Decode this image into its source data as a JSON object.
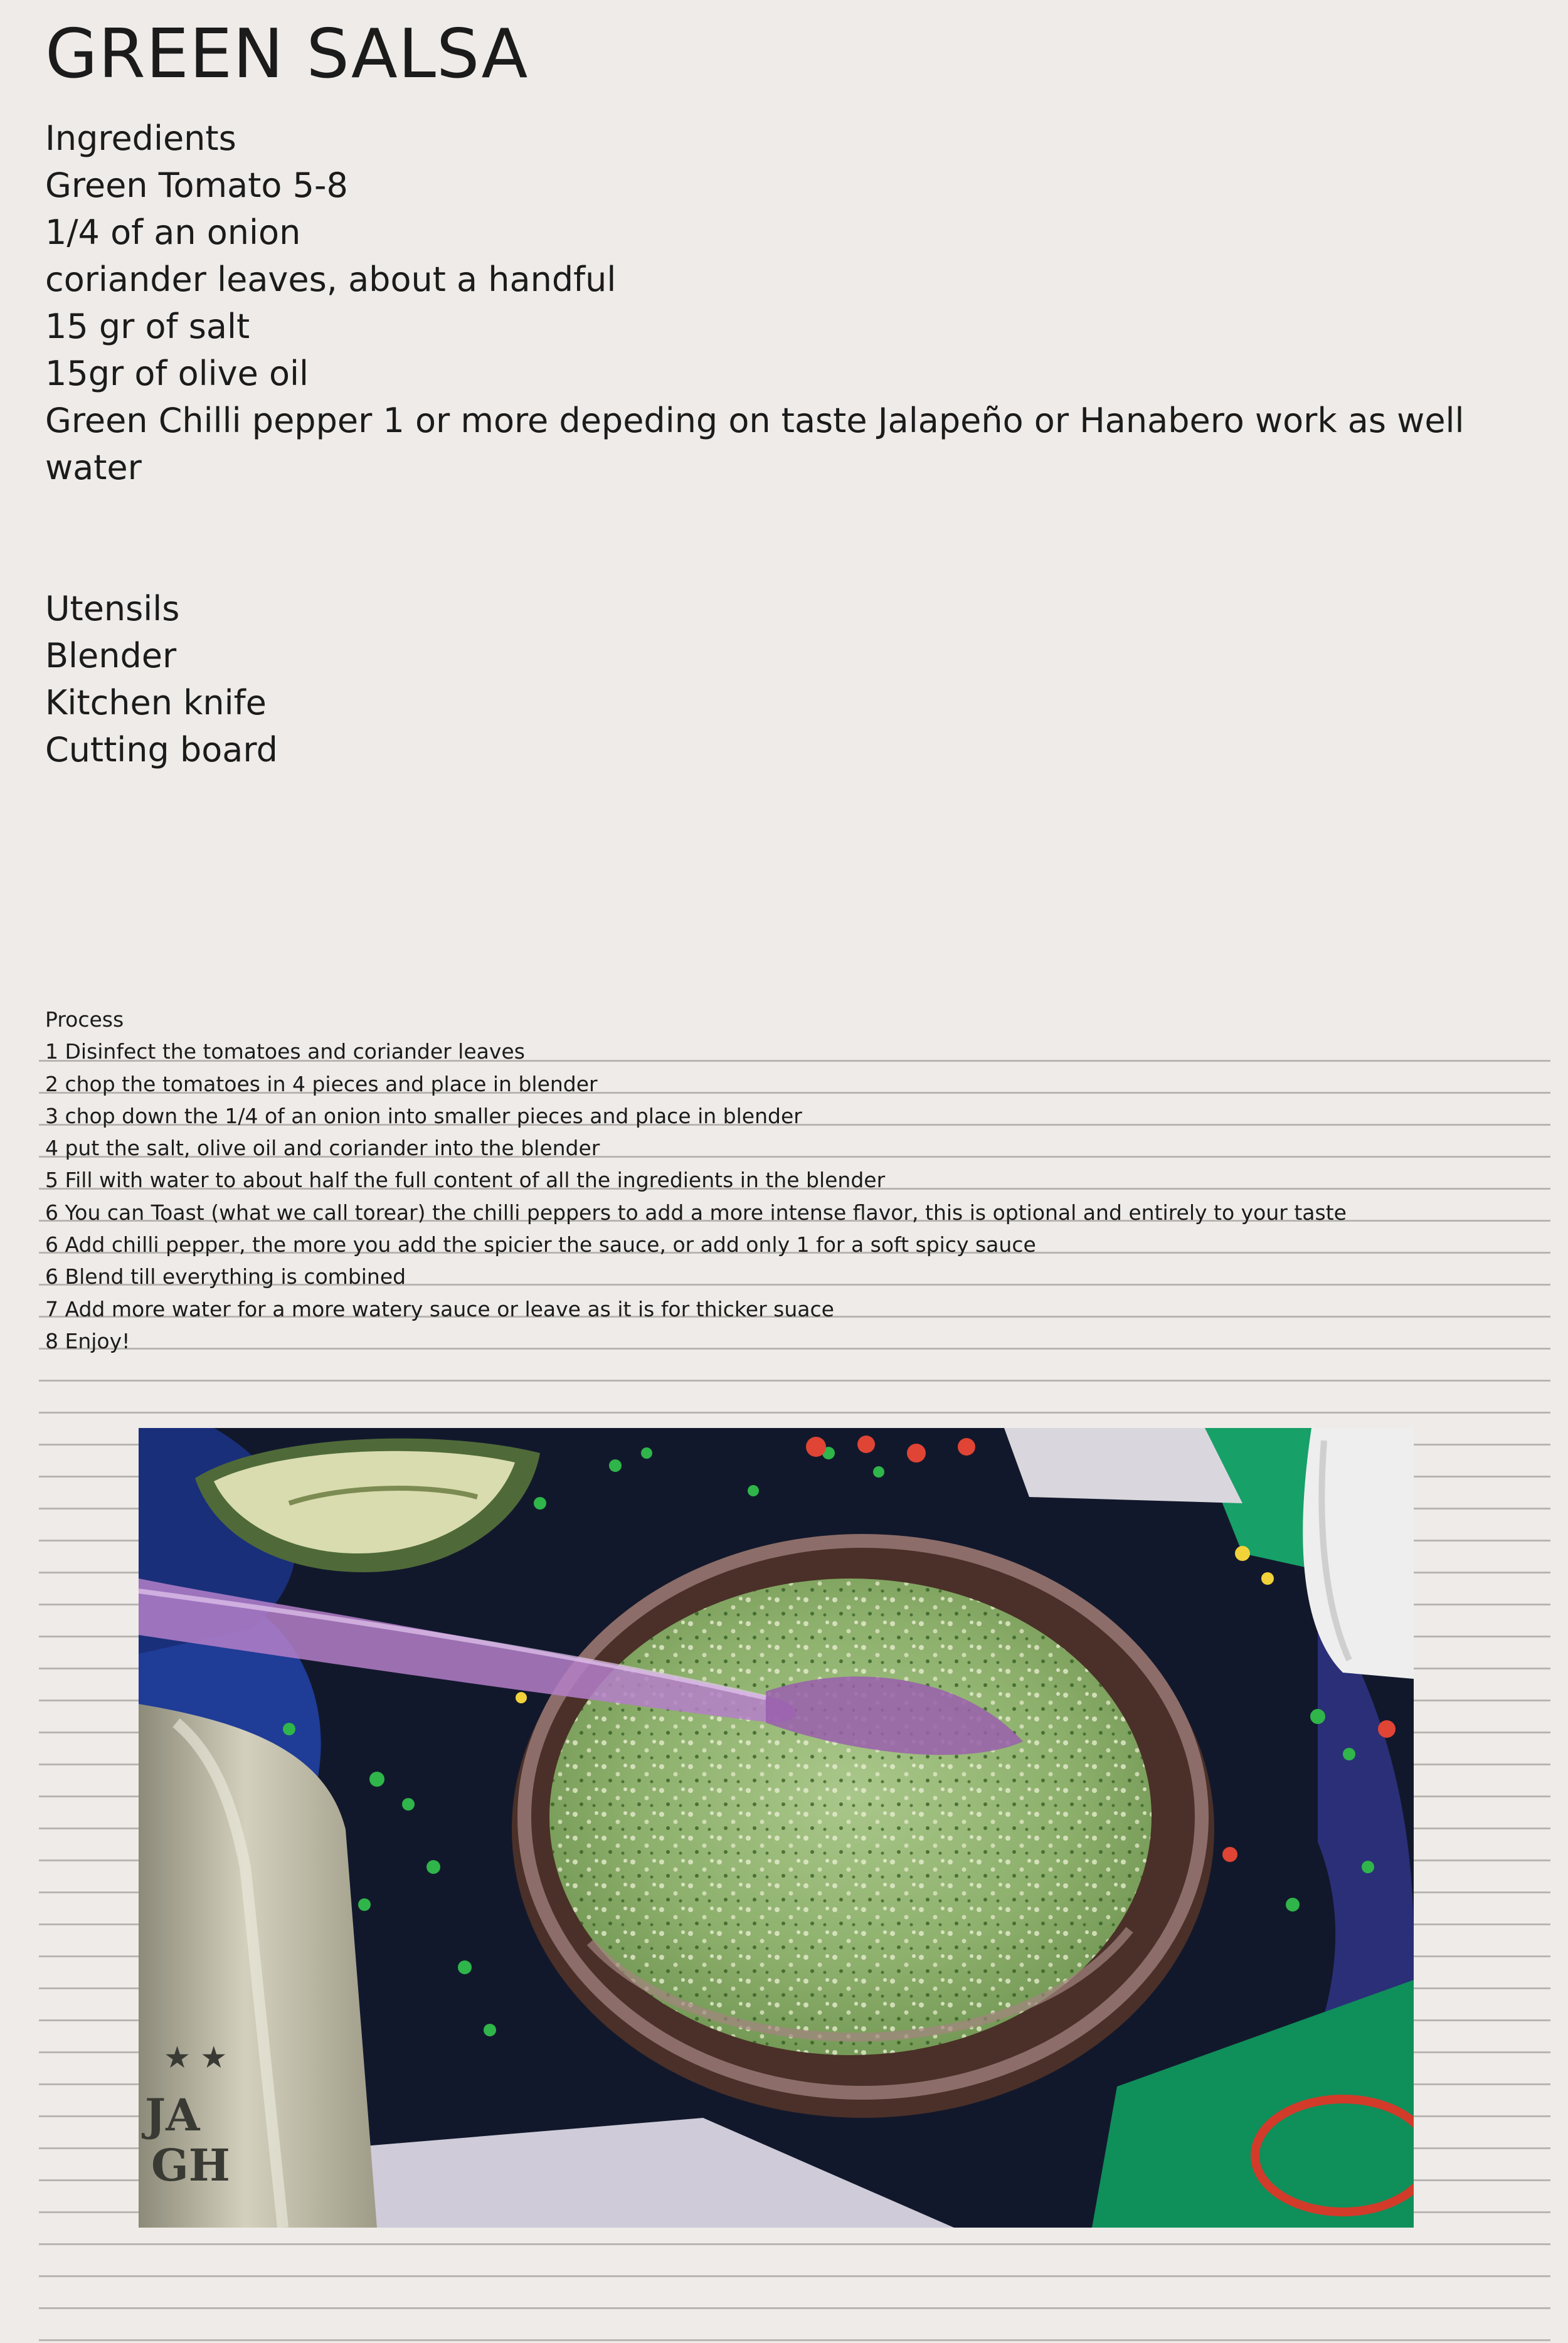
{
  "recipe": {
    "title": "GREEN SALSA",
    "ingredients": {
      "heading": "Ingredients",
      "items": [
        "Green Tomato 5-8",
        "1/4 of an onion",
        "coriander leaves, about a handful",
        "15 gr of salt",
        "15gr of olive oil",
        "Green Chilli pepper 1 or more depeding on taste Jalapeño or Hanabero work as well",
        "water"
      ]
    },
    "utensils": {
      "heading": "Utensils",
      "items": [
        "Blender",
        "Kitchen knife",
        "Cutting board"
      ]
    },
    "process": {
      "heading": "Process",
      "steps": [
        "1 Disinfect the tomatoes and coriander leaves",
        "2 chop the tomatoes in 4 pieces and place in blender",
        "3 chop down the 1/4 of an onion into smaller pieces and place in blender",
        "4 put the salt, olive oil and coriander into the blender",
        "5 Fill with water to about half the full content of all the ingredients in the blender",
        "6 You can Toast (what we call torear) the chilli peppers to add a more intense flavor, this is optional and entirely to your taste",
        "6 Add chilli pepper, the more you add the spicier the sauce, or add only 1 for a soft spicy sauce",
        "6 Blend till everything is combined",
        "7 Add more water for a more watery sauce or leave as it is for thicker suace",
        "8 Enjoy!"
      ]
    },
    "photo": {
      "icon": "salsa-bowl-photo"
    }
  }
}
